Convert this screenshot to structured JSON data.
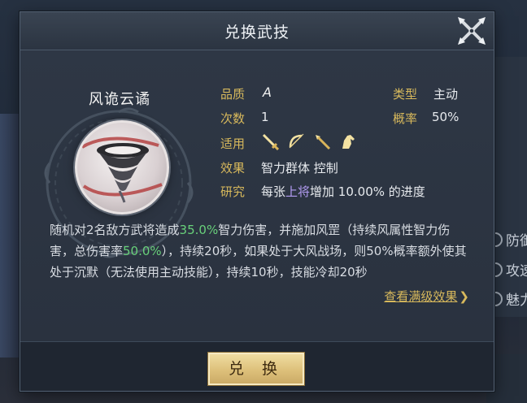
{
  "dialog": {
    "title": "兑换武技",
    "close_label": "close"
  },
  "skill": {
    "name": "风诡云谲",
    "rows": [
      {
        "label": "品质",
        "value": "A"
      },
      {
        "label": "次数",
        "value": "1"
      },
      {
        "label": "适用",
        "value": ""
      },
      {
        "label": "效果",
        "value": "智力群体 控制"
      },
      {
        "label": "研究",
        "value_prefix": "每张",
        "value_highlight": "上将",
        "value_suffix": "增加 10.00% 的进度"
      }
    ],
    "type_label": "类型",
    "type_value": "主动",
    "rate_label": "概率",
    "rate_value": "50%",
    "weapon_icons": [
      "sword-icon",
      "bow-icon",
      "spear-icon",
      "horse-icon"
    ]
  },
  "description": {
    "p1": "随机对2名敌方武将造成",
    "v1": "35.0%",
    "p2": "智力伤害，并施加风罡（持续风属性智力伤害，总伤害率",
    "v2": "50.0%",
    "p3": "），持续20秒，如果处于大风战场，则50%概率额外使其处于沉默（无法使用主动技能），持续10秒，技能冷却20秒"
  },
  "full_effect_link": "查看满级效果",
  "exchange_button": "兑 换",
  "background": {
    "items": [
      "防御",
      "攻速",
      "魅力"
    ]
  },
  "colors": {
    "label_gold": "#d8b95c",
    "highlight_purple": "#b39cf3",
    "value_green": "#68d07a"
  }
}
